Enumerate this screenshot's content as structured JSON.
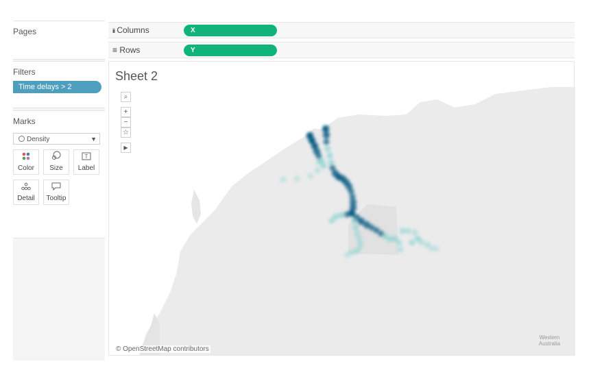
{
  "pages": {
    "title": "Pages"
  },
  "filters": {
    "title": "Filters",
    "items": [
      "Time delays > 2"
    ]
  },
  "marks": {
    "title": "Marks",
    "mark_type": "Density",
    "buttons": [
      "Color",
      "Size",
      "Label",
      "Detail",
      "Tooltip"
    ]
  },
  "shelves": {
    "columns": {
      "label": "Columns",
      "pill": "X"
    },
    "rows": {
      "label": "Rows",
      "pill": "Y"
    }
  },
  "sheet": {
    "title": "Sheet 2",
    "attribution": "© OpenStreetMap contributors",
    "region_label_1": "Western",
    "region_label_2": "Australia"
  },
  "colors": {
    "accent_green": "#10b478",
    "filter_blue": "#4e9fbe",
    "density_dark": "#0d5f86",
    "density_light": "#7fd1cf",
    "land": "#ebebeb"
  }
}
